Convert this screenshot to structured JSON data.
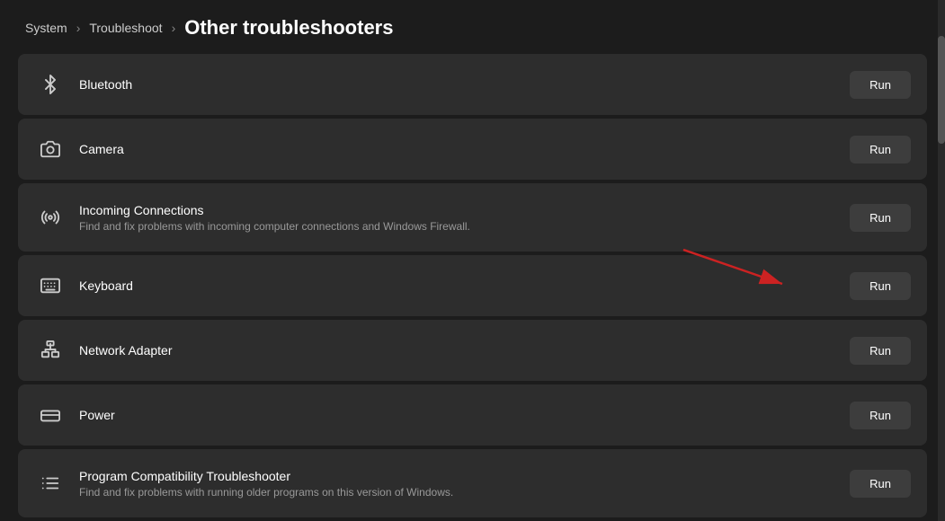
{
  "breadcrumb": {
    "system": "System",
    "sep1": "›",
    "troubleshoot": "Troubleshoot",
    "sep2": "›",
    "current": "Other troubleshooters"
  },
  "items": [
    {
      "id": "bluetooth",
      "icon": "bluetooth",
      "title": "Bluetooth",
      "subtitle": "",
      "run_label": "Run"
    },
    {
      "id": "camera",
      "icon": "camera",
      "title": "Camera",
      "subtitle": "",
      "run_label": "Run"
    },
    {
      "id": "incoming-connections",
      "icon": "incoming",
      "title": "Incoming Connections",
      "subtitle": "Find and fix problems with incoming computer connections and Windows Firewall.",
      "run_label": "Run"
    },
    {
      "id": "keyboard",
      "icon": "keyboard",
      "title": "Keyboard",
      "subtitle": "",
      "run_label": "Run"
    },
    {
      "id": "network-adapter",
      "icon": "network",
      "title": "Network Adapter",
      "subtitle": "",
      "run_label": "Run"
    },
    {
      "id": "power",
      "icon": "power",
      "title": "Power",
      "subtitle": "",
      "run_label": "Run"
    },
    {
      "id": "program-compatibility",
      "icon": "compatibility",
      "title": "Program Compatibility Troubleshooter",
      "subtitle": "Find and fix problems with running older programs on this version of Windows.",
      "run_label": "Run"
    }
  ]
}
